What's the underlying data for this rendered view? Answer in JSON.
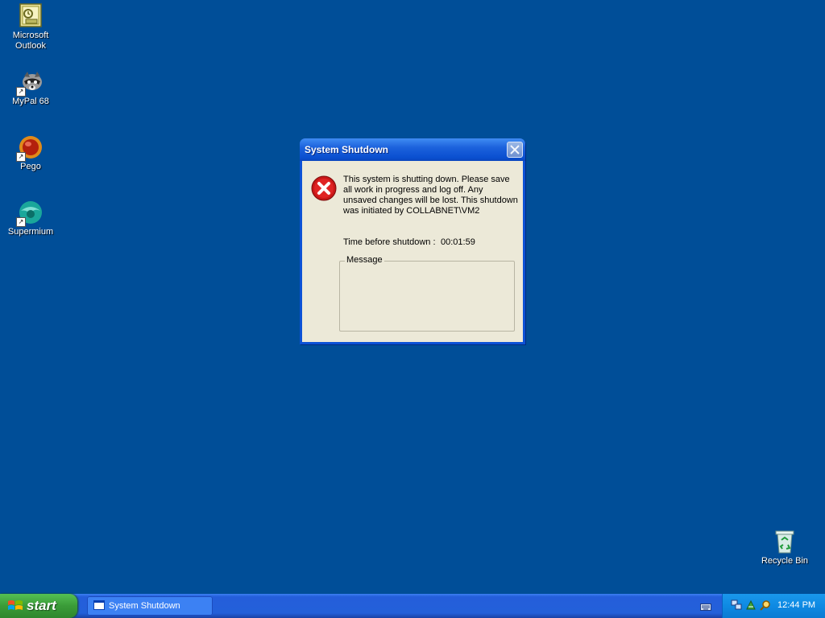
{
  "desktop": {
    "icons": [
      {
        "label_line1": "Microsoft",
        "label_line2": "Outlook"
      },
      {
        "label": "MyPal 68"
      },
      {
        "label": "Pego"
      },
      {
        "label": "Supermium"
      },
      {
        "label": "Recycle Bin"
      }
    ]
  },
  "dialog": {
    "title": "System Shutdown",
    "message": "This system is shutting down. Please save all work in progress and log off. Any unsaved changes will be lost. This shutdown was initiated by COLLABNET\\VM2",
    "time_label": "Time before shutdown :",
    "time_value": "00:01:59",
    "group_label": "Message",
    "icon": "error-icon"
  },
  "taskbar": {
    "start_label": "start",
    "task_button_label": "System Shutdown",
    "clock": "12:44 PM"
  }
}
